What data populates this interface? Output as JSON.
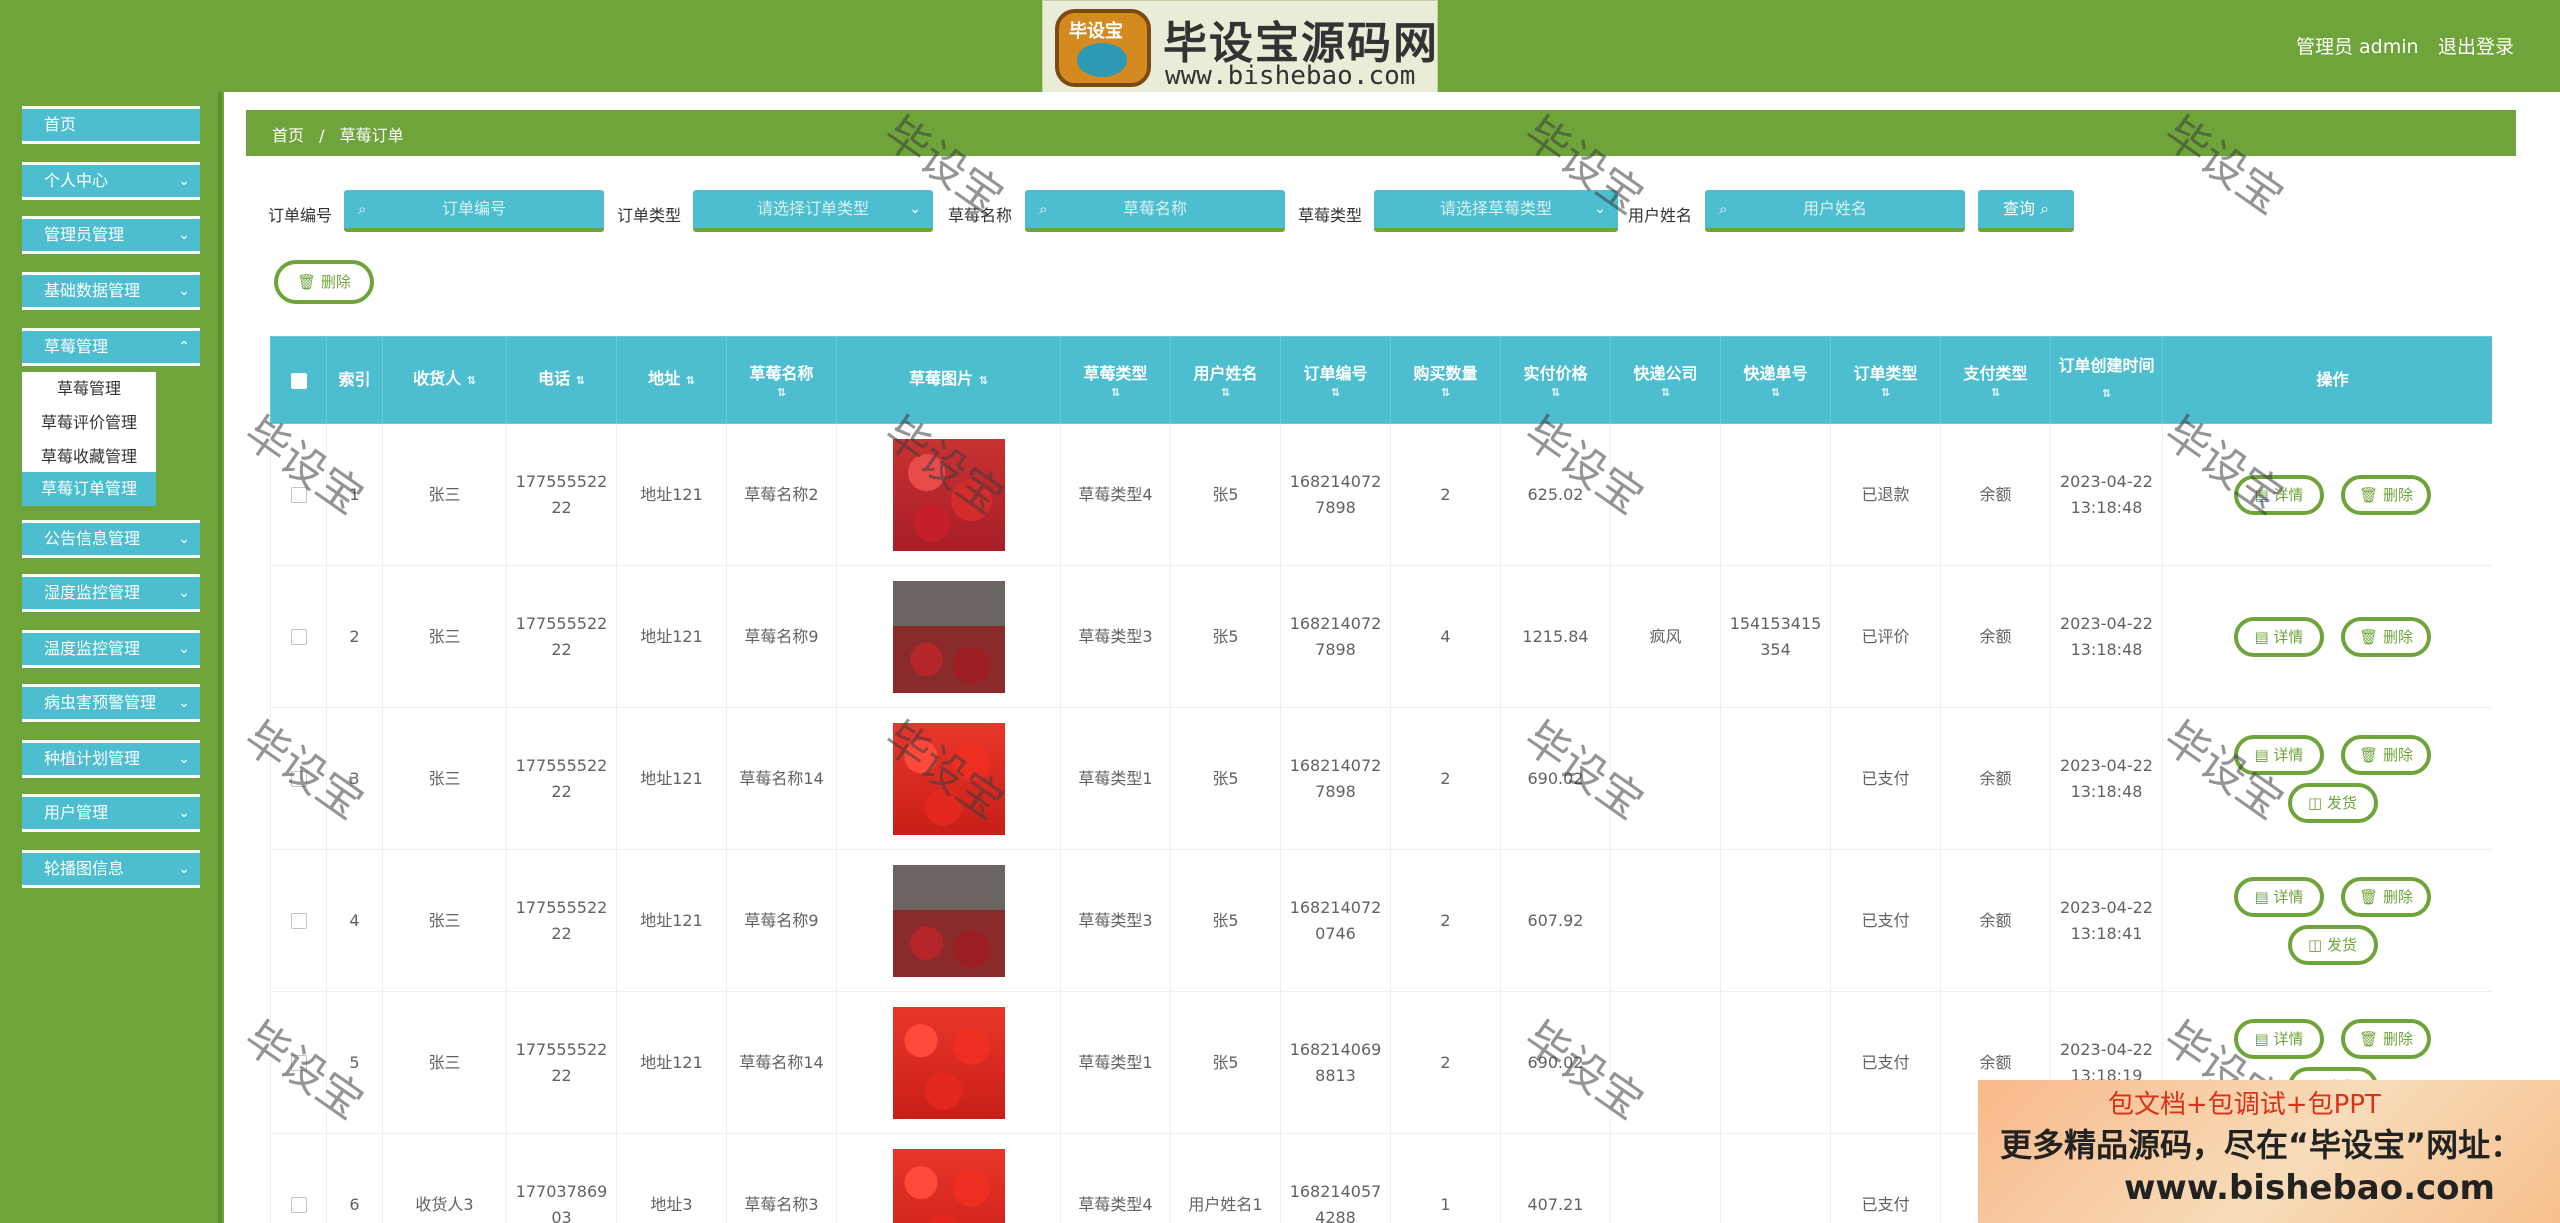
{
  "header": {
    "logo_tag": "毕设宝",
    "logo_title": "毕设宝源码网",
    "logo_url": "www.bishebao.com",
    "user_label": "管理员 admin",
    "logout_label": "退出登录"
  },
  "sidebar": {
    "items": [
      {
        "label": "首页"
      },
      {
        "label": "个人中心"
      },
      {
        "label": "管理员管理"
      },
      {
        "label": "基础数据管理"
      },
      {
        "label": "草莓管理"
      },
      {
        "label": "公告信息管理"
      },
      {
        "label": "湿度监控管理"
      },
      {
        "label": "温度监控管理"
      },
      {
        "label": "病虫害预警管理"
      },
      {
        "label": "种植计划管理"
      },
      {
        "label": "用户管理"
      },
      {
        "label": "轮播图信息"
      }
    ],
    "submenu": [
      "草莓管理",
      "草莓评价管理",
      "草莓收藏管理",
      "草莓订单管理"
    ]
  },
  "breadcrumb": {
    "home": "首页",
    "sep": "/",
    "current": "草莓订单"
  },
  "filters": {
    "order_no_label": "订单编号",
    "order_no_placeholder": "订单编号",
    "order_type_label": "订单类型",
    "order_type_placeholder": "请选择订单类型",
    "name_label": "草莓名称",
    "name_placeholder": "草莓名称",
    "type_label": "草莓类型",
    "type_placeholder": "请选择草莓类型",
    "user_label": "用户姓名",
    "user_placeholder": "用户姓名",
    "query_label": "查询"
  },
  "bulk_delete_label": "删除",
  "table": {
    "headers": [
      "索引",
      "收货人",
      "电话",
      "地址",
      "草莓名称",
      "草莓图片",
      "草莓类型",
      "用户姓名",
      "订单编号",
      "购买数量",
      "实付价格",
      "快递公司",
      "快递单号",
      "订单类型",
      "支付类型",
      "订单创建时间",
      "操作"
    ],
    "rows": [
      {
        "idx": "1",
        "receiver": "张三",
        "phone": "17755552222",
        "addr": "地址121",
        "name": "草莓名称2",
        "type": "草莓类型4",
        "user": "张5",
        "order_no": "1682140727898",
        "qty": "2",
        "price": "625.02",
        "courier": "",
        "tracking": "",
        "order_type": "已退款",
        "pay": "余额",
        "time": "2023-04-22 13:18:48",
        "ship": false,
        "img": "a"
      },
      {
        "idx": "2",
        "receiver": "张三",
        "phone": "17755552222",
        "addr": "地址121",
        "name": "草莓名称9",
        "type": "草莓类型3",
        "user": "张5",
        "order_no": "1682140727898",
        "qty": "4",
        "price": "1215.84",
        "courier": "疯风",
        "tracking": "154153415354",
        "order_type": "已评价",
        "pay": "余额",
        "time": "2023-04-22 13:18:48",
        "ship": false,
        "img": "b"
      },
      {
        "idx": "3",
        "receiver": "张三",
        "phone": "17755552222",
        "addr": "地址121",
        "name": "草莓名称14",
        "type": "草莓类型1",
        "user": "张5",
        "order_no": "1682140727898",
        "qty": "2",
        "price": "690.02",
        "courier": "",
        "tracking": "",
        "order_type": "已支付",
        "pay": "余额",
        "time": "2023-04-22 13:18:48",
        "ship": true,
        "img": "c"
      },
      {
        "idx": "4",
        "receiver": "张三",
        "phone": "17755552222",
        "addr": "地址121",
        "name": "草莓名称9",
        "type": "草莓类型3",
        "user": "张5",
        "order_no": "1682140720746",
        "qty": "2",
        "price": "607.92",
        "courier": "",
        "tracking": "",
        "order_type": "已支付",
        "pay": "余额",
        "time": "2023-04-22 13:18:41",
        "ship": true,
        "img": "b"
      },
      {
        "idx": "5",
        "receiver": "张三",
        "phone": "17755552222",
        "addr": "地址121",
        "name": "草莓名称14",
        "type": "草莓类型1",
        "user": "张5",
        "order_no": "1682140698813",
        "qty": "2",
        "price": "690.02",
        "courier": "",
        "tracking": "",
        "order_type": "已支付",
        "pay": "余额",
        "time": "2023-04-22 13:18:19",
        "ship": true,
        "img": "c"
      },
      {
        "idx": "6",
        "receiver": "收货人3",
        "phone": "17703786903",
        "addr": "地址3",
        "name": "草莓名称3",
        "type": "草莓类型4",
        "user": "用户姓名1",
        "order_no": "1682140574288",
        "qty": "1",
        "price": "407.21",
        "courier": "",
        "tracking": "",
        "order_type": "已支付",
        "pay": "余额",
        "time": "",
        "ship": true,
        "img": "c"
      }
    ],
    "detail_label": "详情",
    "delete_label": "删除",
    "ship_label": "发货"
  },
  "watermark": "毕设宝",
  "ad": {
    "line1": "包文档+包调试+包PPT",
    "line2": "更多精品源码，尽在“毕设宝”网址：",
    "line3": "www.bishebao.com"
  },
  "colors": {
    "primary_green": "#6fa43a",
    "accent_cyan": "#4dbecf"
  }
}
